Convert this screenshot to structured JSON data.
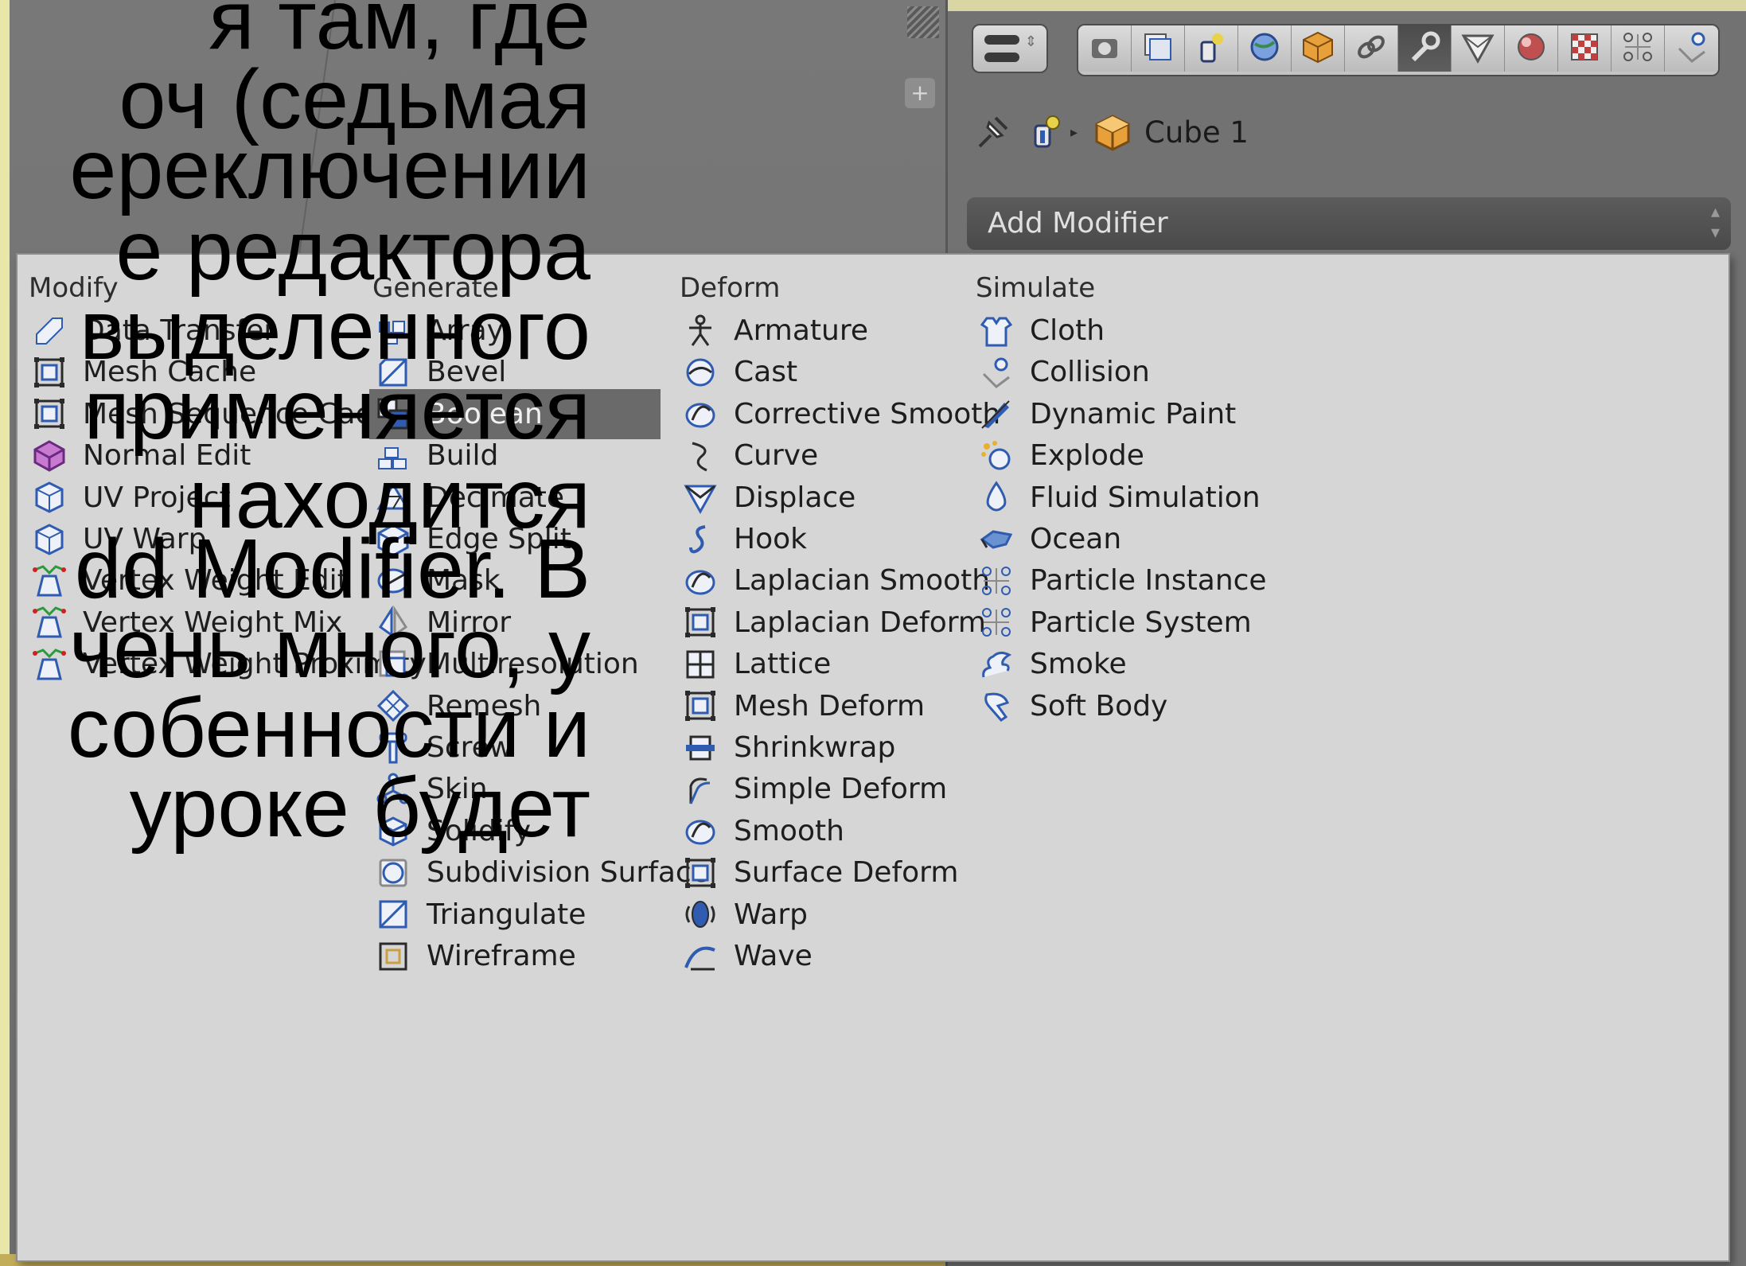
{
  "slide": {
    "lines": [
      "я там, где",
      "оч (седьмая",
      "ереключении",
      "е редактора",
      "выделенного",
      "применяется",
      "находится",
      "dd Modifier. В",
      "чень много, у",
      "собенности и",
      "уроке будет"
    ]
  },
  "properties": {
    "object_name": "Cube 1",
    "add_modifier_label": "Add Modifier",
    "tabs": [
      "render-icon",
      "render-layers-icon",
      "scene-icon",
      "world-icon",
      "object-icon",
      "constraints-icon",
      "modifiers-wrench-icon",
      "data-icon",
      "material-icon",
      "texture-icon",
      "particles-icon",
      "physics-icon"
    ],
    "active_tab": 6
  },
  "menu": {
    "columns": [
      {
        "title": "Modify",
        "items": [
          {
            "label": "Data Transfer",
            "icon": "data-transfer-icon"
          },
          {
            "label": "Mesh Cache",
            "icon": "mesh-cache-icon"
          },
          {
            "label": "Mesh Sequence Cache",
            "icon": "mesh-sequence-cache-icon"
          },
          {
            "label": "Normal Edit",
            "icon": "normal-edit-icon"
          },
          {
            "label": "UV Project",
            "icon": "uv-project-icon"
          },
          {
            "label": "UV Warp",
            "icon": "uv-warp-icon"
          },
          {
            "label": "Vertex Weight Edit",
            "icon": "vertex-weight-icon"
          },
          {
            "label": "Vertex Weight Mix",
            "icon": "vertex-weight-icon"
          },
          {
            "label": "Vertex Weight Proximity",
            "icon": "vertex-weight-icon"
          }
        ]
      },
      {
        "title": "Generate",
        "items": [
          {
            "label": "Array",
            "icon": "array-icon"
          },
          {
            "label": "Bevel",
            "icon": "bevel-icon"
          },
          {
            "label": "Boolean",
            "icon": "boolean-icon"
          },
          {
            "label": "Build",
            "icon": "build-icon"
          },
          {
            "label": "Decimate",
            "icon": "decimate-icon"
          },
          {
            "label": "Edge Split",
            "icon": "edge-split-icon"
          },
          {
            "label": "Mask",
            "icon": "mask-icon"
          },
          {
            "label": "Mirror",
            "icon": "mirror-icon"
          },
          {
            "label": "Multiresolution",
            "icon": "multiresolution-icon"
          },
          {
            "label": "Remesh",
            "icon": "remesh-icon"
          },
          {
            "label": "Screw",
            "icon": "screw-icon"
          },
          {
            "label": "Skin",
            "icon": "skin-icon"
          },
          {
            "label": "Solidify",
            "icon": "solidify-icon"
          },
          {
            "label": "Subdivision Surface",
            "icon": "subdivision-surface-icon"
          },
          {
            "label": "Triangulate",
            "icon": "triangulate-icon"
          },
          {
            "label": "Wireframe",
            "icon": "wireframe-icon"
          }
        ]
      },
      {
        "title": "Deform",
        "items": [
          {
            "label": "Armature",
            "icon": "armature-icon"
          },
          {
            "label": "Cast",
            "icon": "cast-icon"
          },
          {
            "label": "Corrective Smooth",
            "icon": "smooth-icon"
          },
          {
            "label": "Curve",
            "icon": "curve-icon"
          },
          {
            "label": "Displace",
            "icon": "displace-icon"
          },
          {
            "label": "Hook",
            "icon": "hook-icon"
          },
          {
            "label": "Laplacian Smooth",
            "icon": "smooth-icon"
          },
          {
            "label": "Laplacian Deform",
            "icon": "lattice-frame-icon"
          },
          {
            "label": "Lattice",
            "icon": "lattice-icon"
          },
          {
            "label": "Mesh Deform",
            "icon": "lattice-frame-icon"
          },
          {
            "label": "Shrinkwrap",
            "icon": "shrinkwrap-icon"
          },
          {
            "label": "Simple Deform",
            "icon": "simple-deform-icon"
          },
          {
            "label": "Smooth",
            "icon": "smooth-icon"
          },
          {
            "label": "Surface Deform",
            "icon": "lattice-frame-icon"
          },
          {
            "label": "Warp",
            "icon": "warp-icon"
          },
          {
            "label": "Wave",
            "icon": "wave-icon"
          }
        ]
      },
      {
        "title": "Simulate",
        "items": [
          {
            "label": "Cloth",
            "icon": "cloth-icon"
          },
          {
            "label": "Collision",
            "icon": "collision-icon"
          },
          {
            "label": "Dynamic Paint",
            "icon": "dynamic-paint-icon"
          },
          {
            "label": "Explode",
            "icon": "explode-icon"
          },
          {
            "label": "Fluid Simulation",
            "icon": "fluid-icon"
          },
          {
            "label": "Ocean",
            "icon": "ocean-icon"
          },
          {
            "label": "Particle Instance",
            "icon": "particles-icon"
          },
          {
            "label": "Particle System",
            "icon": "particles-icon"
          },
          {
            "label": "Smoke",
            "icon": "smoke-icon"
          },
          {
            "label": "Soft Body",
            "icon": "soft-body-icon"
          }
        ]
      }
    ],
    "highlighted": "Boolean"
  }
}
